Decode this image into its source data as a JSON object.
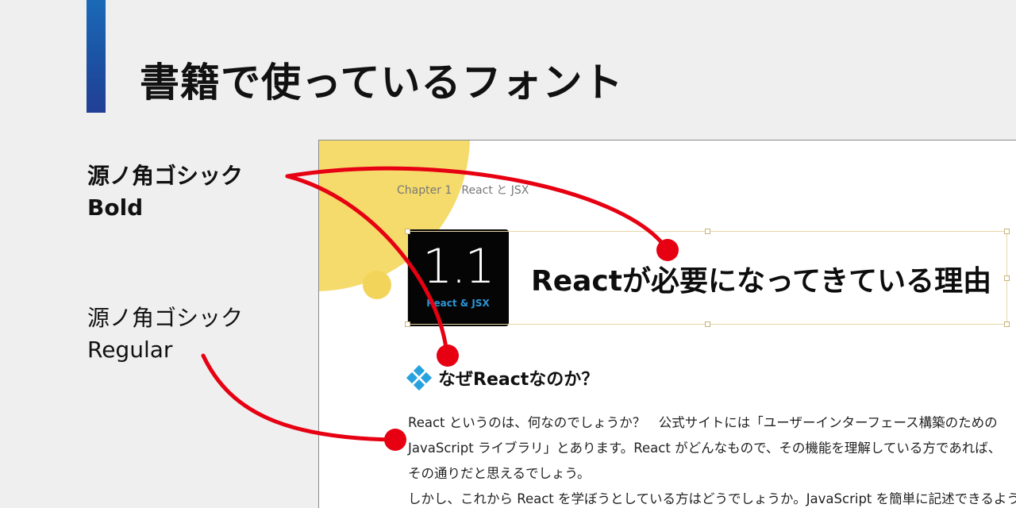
{
  "slide": {
    "title": "書籍で使っているフォント"
  },
  "labels": {
    "bold": {
      "line1": "源ノ角ゴシック",
      "line2": "Bold"
    },
    "regular": {
      "line1": "源ノ角ゴシック",
      "line2": "Regular"
    }
  },
  "book_page": {
    "running_head": {
      "chapter": "Chapter 1",
      "topic": "React と JSX"
    },
    "chapter_box": {
      "number": "1.1",
      "subtitle": "React & JSX"
    },
    "section_title": "Reactが必要になってきている理由",
    "subheading": "なぜReactなのか？",
    "paragraphs": [
      "React というのは、何なのでしょうか？　公式サイトには「ユーザーインターフェース構築のための",
      "JavaScript ライブラリ」とあります。React がどんなもので、その機能を理解している方であれば、",
      "その通りだと思えるでしょう。",
      "しかし、これから React を学ぼうとしている方はどうでしょうか。JavaScript を簡単に記述できるよう"
    ]
  },
  "colors": {
    "accent_bar": "#1d4fa0",
    "annotation_red": "#e60012",
    "deco_yellow": "#f5db6c",
    "diamond_icon": "#28a2de"
  }
}
